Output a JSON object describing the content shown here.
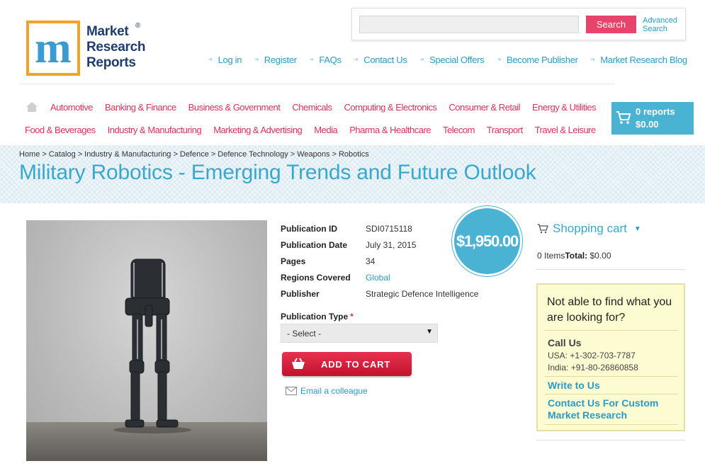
{
  "logo": {
    "line1": "Market",
    "line2": "Research",
    "line3": "Reports",
    "reg": "®",
    "letter": "m",
    "colors": {
      "border": "#f2a42a",
      "text": "#1f3d6b",
      "mark": "#3a9bd1"
    }
  },
  "search": {
    "placeholder": "",
    "button": "Search",
    "advanced_line1": "Advanced",
    "advanced_line2": "Search"
  },
  "top_links": [
    "Log in",
    "Register",
    "FAQs",
    "Contact Us",
    "Special Offers",
    "Become Publisher",
    "Market Research Blog"
  ],
  "categories_row1": [
    "Automotive",
    "Banking & Finance",
    "Business & Government",
    "Chemicals",
    "Computing & Electronics",
    "Consumer & Retail",
    "Energy & Utilities"
  ],
  "categories_row2": [
    "Food & Beverages",
    "Industry & Manufacturing",
    "Marketing & Advertising",
    "Media",
    "Pharma & Healthcare",
    "Telecom",
    "Transport",
    "Travel & Leisure"
  ],
  "cart_widget": {
    "count": "0 reports",
    "total": "$0.00"
  },
  "breadcrumb": [
    "Home",
    "Catalog",
    "Industry & Manufacturing",
    "Defence",
    "Defence Technology",
    "Weapons",
    "Robotics"
  ],
  "breadcrumb_sep": ">",
  "title": "Military Robotics - Emerging Trends and Future Outlook",
  "details": [
    {
      "label": "Publication ID",
      "value": "SDI0715118"
    },
    {
      "label": "Publication Date",
      "value": "July 31, 2015"
    },
    {
      "label": "Pages",
      "value": "34"
    },
    {
      "label": "Regions Covered",
      "value": "Global"
    },
    {
      "label": "Publisher",
      "value": "Strategic Defence Intelligence"
    }
  ],
  "price": "$1,950.00",
  "publication_type": {
    "label": "Publication Type",
    "required": "*",
    "selected": "- Select -"
  },
  "add_to_cart": "ADD TO CART",
  "email_colleague": "Email a colleague",
  "sidebar": {
    "cart_title": "Shopping cart",
    "items_text": "0 Items",
    "total_label": "Total:",
    "total_value": " $0.00",
    "help_heading": "Not able to find what you are looking for?",
    "call_us": "Call Us",
    "phone_usa": "USA: +1-302-703-7787",
    "phone_india": "India: +91-80-26860858",
    "write_to_us": "Write to Us",
    "custom_research": "Contact Us For Custom Market Research"
  },
  "colors": {
    "accent_blue": "#38a8cf",
    "category_red": "#e0305c",
    "button_red": "#d21d3b",
    "badge_blue": "#4ab3d4",
    "help_bg": "#fdfbd1"
  }
}
